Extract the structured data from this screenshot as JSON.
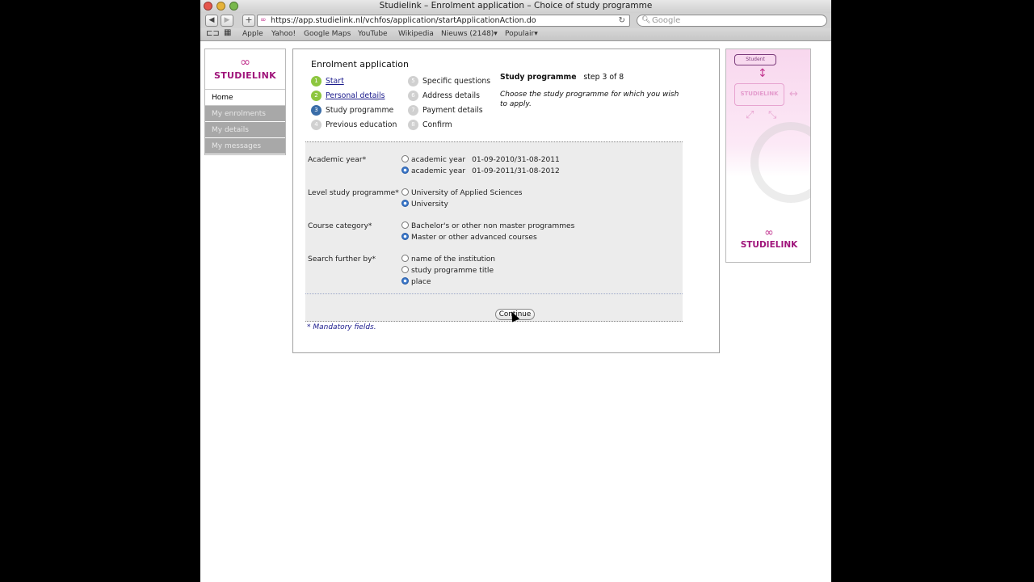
{
  "window": {
    "title": "Studielink – Enrolment application – Choice of study programme"
  },
  "toolbar": {
    "back_icon": "back-arrow-icon",
    "forward_icon": "forward-arrow-icon",
    "add_icon": "+",
    "url": "https://app.studielink.nl/vchfos/application/startApplicationAction.do",
    "reload_icon": "C",
    "search_placeholder": "Google"
  },
  "bookmarks": {
    "items": [
      "Apple",
      "Yahoo!",
      "Google Maps",
      "YouTube",
      "Wikipedia",
      "Nieuws (2148)▾",
      "Populair▾"
    ]
  },
  "sidebar": {
    "logo_text": "STUDIELINK",
    "items": [
      {
        "label": "Home"
      },
      {
        "label": "My enrolments"
      },
      {
        "label": "My details"
      },
      {
        "label": "My messages"
      }
    ]
  },
  "main": {
    "title": "Enrolment application",
    "steps": [
      {
        "num": "1",
        "label": "Start"
      },
      {
        "num": "2",
        "label": "Personal details"
      },
      {
        "num": "3",
        "label": "Study programme"
      },
      {
        "num": "4",
        "label": "Previous education"
      },
      {
        "num": "5",
        "label": "Specific questions"
      },
      {
        "num": "6",
        "label": "Address details"
      },
      {
        "num": "7",
        "label": "Payment details"
      },
      {
        "num": "8",
        "label": "Confirm"
      }
    ],
    "step_header": "Study programme",
    "step_counter": "step 3 of 8",
    "step_description": "Choose the study programme for which you wish to apply.",
    "form": {
      "academic_year": {
        "label": "Academic year*",
        "options": [
          {
            "text": "academic year",
            "date": "01-09-2010/31-08-2011",
            "selected": false
          },
          {
            "text": "academic year",
            "date": "01-09-2011/31-08-2012",
            "selected": true
          }
        ]
      },
      "level": {
        "label": "Level study programme*",
        "options": [
          {
            "text": "University of Applied Sciences",
            "selected": false
          },
          {
            "text": "University",
            "selected": true
          }
        ]
      },
      "category": {
        "label": "Course category*",
        "options": [
          {
            "text": "Bachelor's or other non master programmes",
            "selected": false
          },
          {
            "text": "Master or other advanced courses",
            "selected": true
          }
        ]
      },
      "search_by": {
        "label": "Search further by*",
        "options": [
          {
            "text": "name of the institution",
            "selected": false
          },
          {
            "text": "study programme title",
            "selected": false
          },
          {
            "text": "place",
            "selected": true
          }
        ]
      },
      "continue_label": "Continue",
      "mandatory_note": "* Mandatory fields."
    }
  },
  "banner": {
    "box_label": "Student",
    "center_label": "STUDIELINK",
    "logo_text": "STUDIELINK"
  }
}
